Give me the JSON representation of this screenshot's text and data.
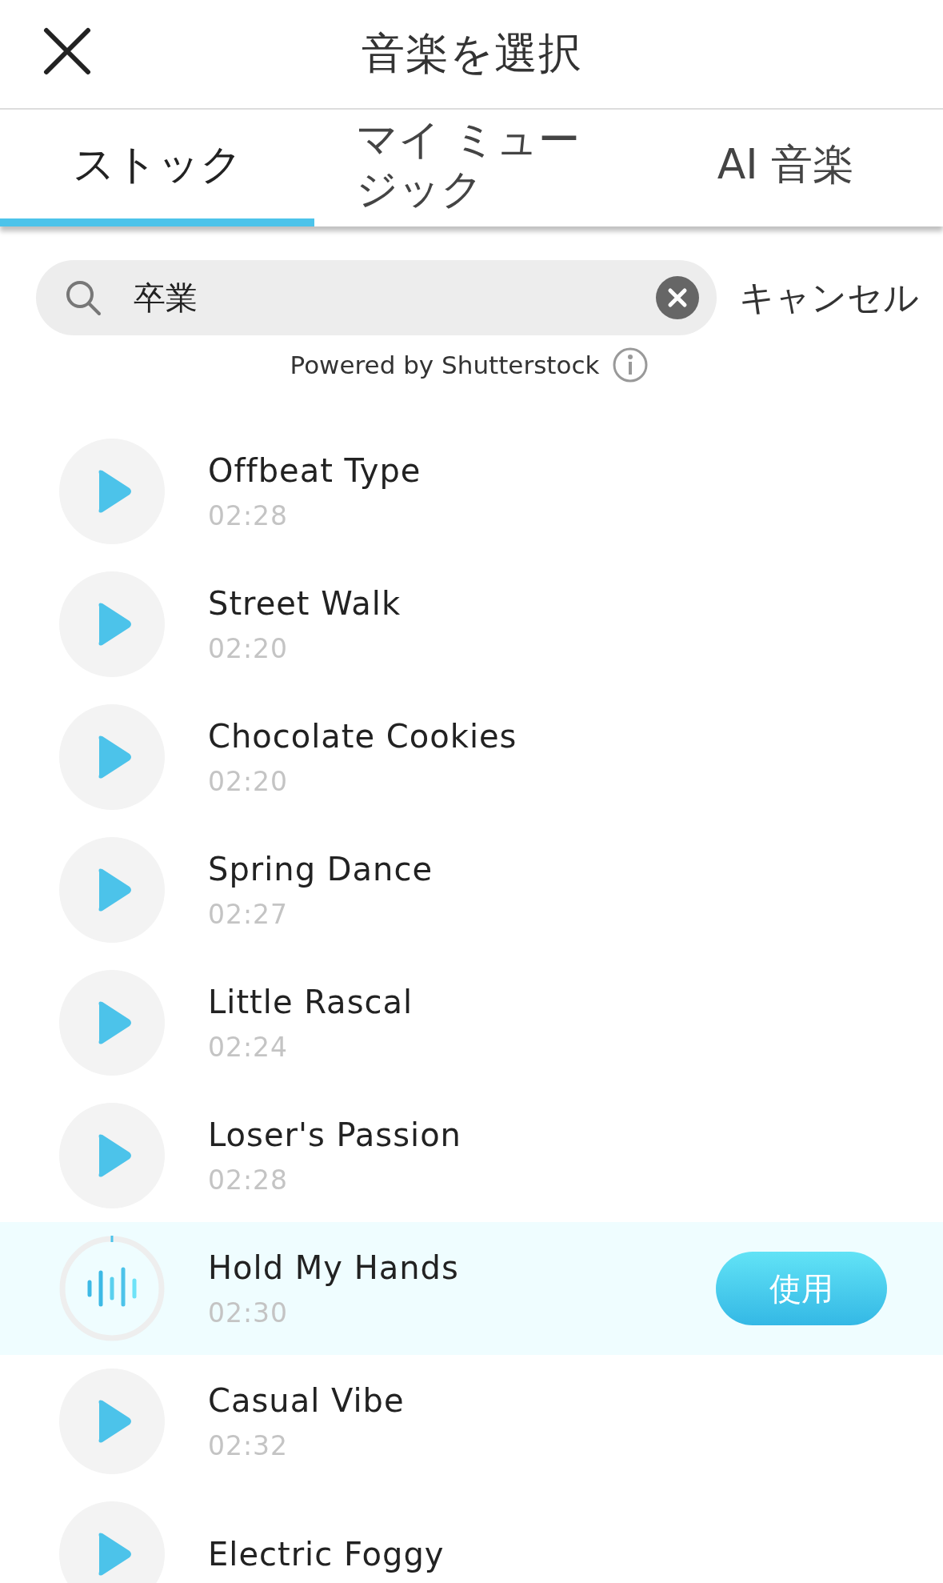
{
  "header": {
    "title": "音楽を選択"
  },
  "tabs": [
    {
      "label": "ストック",
      "selected": true
    },
    {
      "label": "マイ ミュージック",
      "selected": false
    },
    {
      "label": "AI 音楽",
      "selected": false
    }
  ],
  "search": {
    "value": "卒業",
    "cancel": "キャンセル"
  },
  "powered_by": "Powered by Shutterstock",
  "use_button": "使用",
  "tracks": [
    {
      "title": "Offbeat Type",
      "duration": "02:28",
      "selected": false
    },
    {
      "title": "Street Walk",
      "duration": "02:20",
      "selected": false
    },
    {
      "title": "Chocolate Cookies",
      "duration": "02:20",
      "selected": false
    },
    {
      "title": "Spring Dance",
      "duration": "02:27",
      "selected": false
    },
    {
      "title": "Little Rascal",
      "duration": "02:24",
      "selected": false
    },
    {
      "title": "Loser's Passion",
      "duration": "02:28",
      "selected": false
    },
    {
      "title": "Hold My Hands",
      "duration": "02:30",
      "selected": true
    },
    {
      "title": "Casual Vibe",
      "duration": "02:32",
      "selected": false
    },
    {
      "title": "Electric Foggy",
      "selected": false
    }
  ]
}
